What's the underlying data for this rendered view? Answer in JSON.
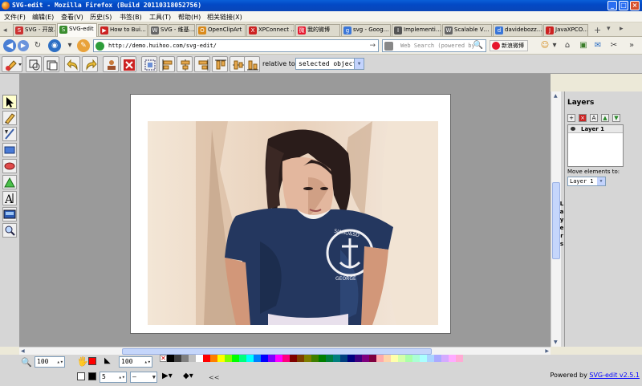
{
  "window": {
    "title": "SVG-edit - Mozilla Firefox (Build 20110318052756)",
    "min": "_",
    "max": "□",
    "close": "×"
  },
  "menu": [
    "文件(F)",
    "编辑(E)",
    "查看(V)",
    "历史(S)",
    "书签(B)",
    "工具(T)",
    "帮助(H)",
    "相关链接(X)"
  ],
  "tabs": [
    {
      "label": "SVG - 开放…",
      "color": "#cc3333",
      "glyph": "S"
    },
    {
      "label": "SVG-edit",
      "color": "#3a8d2f",
      "glyph": "S",
      "active": true
    },
    {
      "label": "How to Bui…",
      "color": "#cc2222",
      "glyph": "▶"
    },
    {
      "label": "SVG - 维基…",
      "color": "#666666",
      "glyph": "W"
    },
    {
      "label": "OpenClipArt",
      "color": "#d98a1b",
      "glyph": "O"
    },
    {
      "label": "XPConnect …",
      "color": "#cc2222",
      "glyph": "X"
    },
    {
      "label": "我的微博",
      "color": "#e6162d",
      "glyph": "微"
    },
    {
      "label": "svg - Goog…",
      "color": "#3a76d8",
      "glyph": "g"
    },
    {
      "label": "Implementi…",
      "color": "#555555",
      "glyph": "I"
    },
    {
      "label": "Scalable V…",
      "color": "#666666",
      "glyph": "W"
    },
    {
      "label": "davidebozz…",
      "color": "#3a76d8",
      "glyph": "d"
    },
    {
      "label": "JavaXPCO…",
      "color": "#cc2222",
      "glyph": "J"
    }
  ],
  "tabbar": {
    "new_tab": "+",
    "list": "▾",
    "scroll": "▸"
  },
  "nav": {
    "url": "http://demo.huihoo.com/svg-edit/",
    "search_placeholder": "Web Search (powered by",
    "weibo": "新浪微博",
    "go": "→",
    "search_go": "🔍"
  },
  "toolbar": {
    "relative_label": "relative to:",
    "relative_value": "selected objects",
    "dropdown_arrow": "▼"
  },
  "layers": {
    "title": "Layers",
    "layer_name": "Layer 1",
    "move_label": "Move elements to:",
    "move_value": "Layer 1",
    "vertical_label": [
      "L",
      "a",
      "y",
      "e",
      "r",
      "s"
    ],
    "buttons": [
      "+",
      "×",
      "A",
      "▲",
      "▼"
    ]
  },
  "bottom": {
    "zoom_value": "100",
    "opacity_value": "100",
    "stroke_width": "5",
    "stroke_style": "—",
    "collapse": "<<",
    "powered_prefix": "Powered by ",
    "powered_link": "SVG-edit v2.5.1",
    "spin": "▴▾",
    "fill_color": "#ff0000",
    "stroke_color": "#000000"
  },
  "palette": [
    "#000000",
    "#3f3f3f",
    "#7f7f7f",
    "#bfbfbf",
    "#ffffff",
    "#ff0000",
    "#ff7f00",
    "#ffff00",
    "#7fff00",
    "#00ff00",
    "#00ff7f",
    "#00ffff",
    "#007fff",
    "#0000ff",
    "#7f00ff",
    "#ff00ff",
    "#ff007f",
    "#7f0000",
    "#7f3f00",
    "#7f7f00",
    "#3f7f00",
    "#007f00",
    "#007f3f",
    "#007f7f",
    "#003f7f",
    "#00007f",
    "#3f007f",
    "#7f007f",
    "#7f003f",
    "#ffaaaa",
    "#ffd4aa",
    "#ffffaa",
    "#d4ffaa",
    "#aaffaa",
    "#aaffd4",
    "#aaffff",
    "#aad4ff",
    "#aaaaff",
    "#d4aaff",
    "#ffaaff",
    "#ffaad4"
  ],
  "artwork": {
    "shirt_text_top": "SIANO&SD",
    "shirt_text_bottom": "GEORGE"
  }
}
